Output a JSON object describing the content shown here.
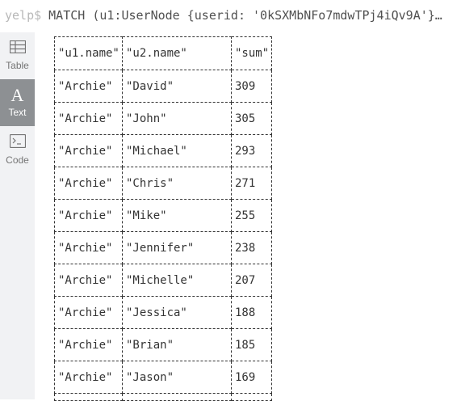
{
  "query": {
    "prompt": "yelp$",
    "text": "MATCH (u1:UserNode {userid: '0kSXMbNFo7mdwTPj4iQv9A'}…"
  },
  "sidebar": {
    "items": [
      {
        "label": "Table",
        "icon": "table-icon",
        "active": false
      },
      {
        "label": "Text",
        "icon": "text-icon",
        "glyph": "A",
        "active": true
      },
      {
        "label": "Code",
        "icon": "code-icon",
        "active": false
      }
    ]
  },
  "table": {
    "headers": [
      "\"u1.name\"",
      "\"u2.name\"",
      "\"sum\""
    ],
    "rows": [
      [
        "\"Archie\"",
        "\"David\"",
        "309"
      ],
      [
        "\"Archie\"",
        "\"John\"",
        "305"
      ],
      [
        "\"Archie\"",
        "\"Michael\"",
        "293"
      ],
      [
        "\"Archie\"",
        "\"Chris\"",
        "271"
      ],
      [
        "\"Archie\"",
        "\"Mike\"",
        "255"
      ],
      [
        "\"Archie\"",
        "\"Jennifer\"",
        "238"
      ],
      [
        "\"Archie\"",
        "\"Michelle\"",
        "207"
      ],
      [
        "\"Archie\"",
        "\"Jessica\"",
        "188"
      ],
      [
        "\"Archie\"",
        "\"Brian\"",
        "185"
      ],
      [
        "\"Archie\"",
        "\"Jason\"",
        "169"
      ]
    ]
  }
}
